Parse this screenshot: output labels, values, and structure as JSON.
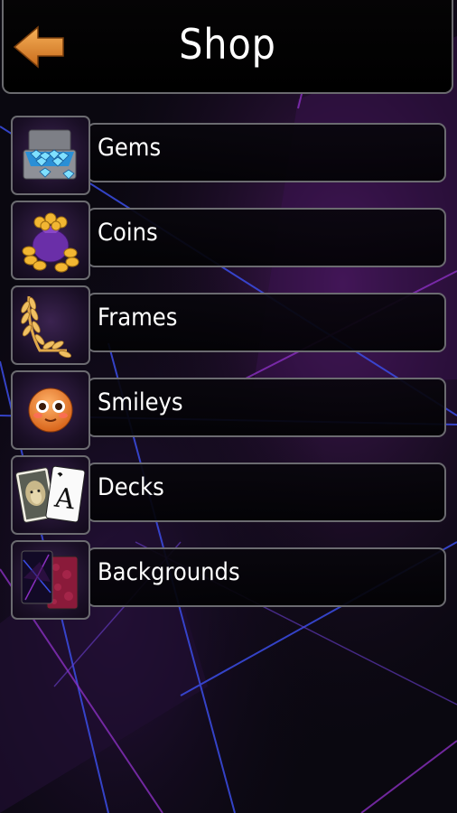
{
  "header": {
    "title": "Shop",
    "back_icon": "back-arrow-icon"
  },
  "menu": {
    "items": [
      {
        "label": "Gems",
        "icon": "gems-chest-icon"
      },
      {
        "label": "Coins",
        "icon": "coins-bag-icon"
      },
      {
        "label": "Frames",
        "icon": "laurel-frame-icon"
      },
      {
        "label": "Smileys",
        "icon": "smiley-face-icon"
      },
      {
        "label": "Decks",
        "icon": "playing-cards-icon"
      },
      {
        "label": "Backgrounds",
        "icon": "backgrounds-cards-icon"
      }
    ]
  },
  "colors": {
    "accent_orange": "#e89436",
    "border_gray": "#6b6b70",
    "background_purple": "#2a0f3a",
    "neon_blue": "#3a4fe0"
  }
}
